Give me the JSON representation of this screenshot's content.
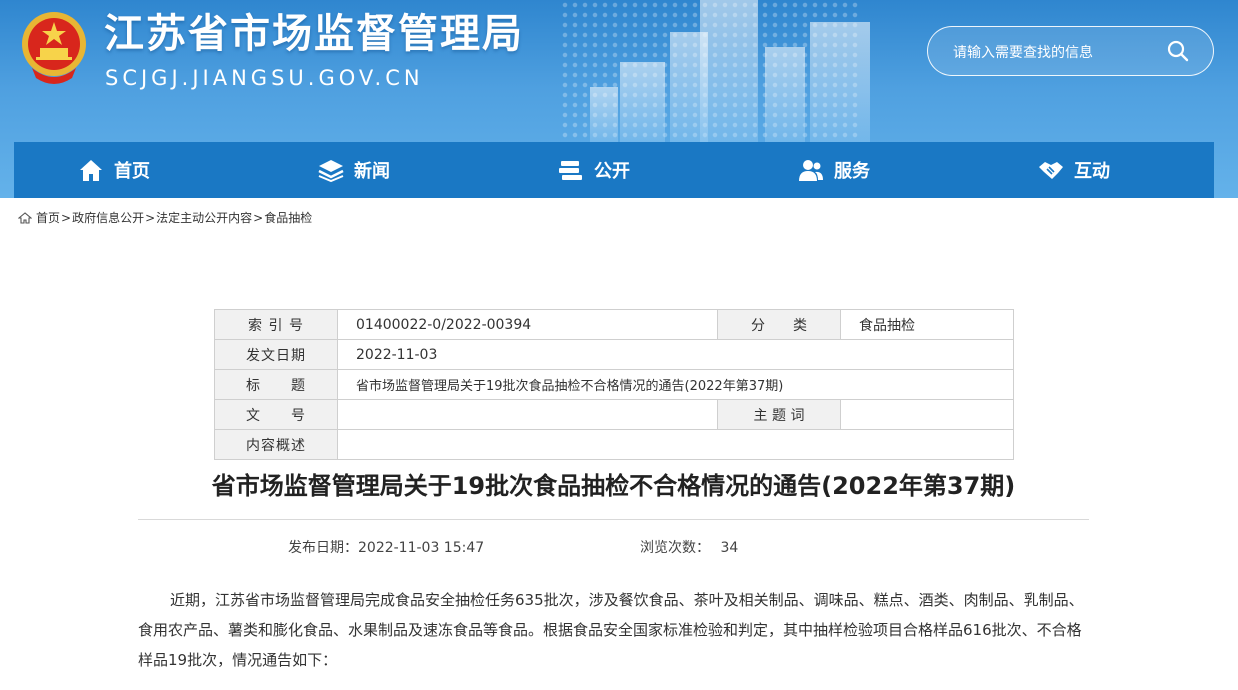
{
  "header": {
    "site_title": "江苏省市场监督管理局",
    "site_domain": "SCJGJ.JIANGSU.GOV.CN",
    "search_placeholder": "请输入需要查找的信息",
    "emblem_icon": "national-emblem-icon",
    "search_icon": "search-icon"
  },
  "nav": {
    "items": [
      {
        "label": "首页",
        "icon": "home-icon"
      },
      {
        "label": "新闻",
        "icon": "layers-icon"
      },
      {
        "label": "公开",
        "icon": "book-stack-icon"
      },
      {
        "label": "服务",
        "icon": "people-icon"
      },
      {
        "label": "互动",
        "icon": "handshake-icon"
      }
    ]
  },
  "breadcrumb": {
    "icon": "home-icon",
    "items": [
      "首页",
      "政府信息公开",
      "法定主动公开内容",
      "食品抽检"
    ],
    "separator": ">"
  },
  "info_table": {
    "index_label": "索 引 号",
    "index_value": "01400022-0/2022-00394",
    "category_label": "分　　类",
    "category_value": "食品抽检",
    "date_label": "发文日期",
    "date_value": "2022-11-03",
    "title_label": "标　　题",
    "title_value": "省市场监督管理局关于19批次食品抽检不合格情况的通告(2022年第37期)",
    "docno_label": "文　　号",
    "docno_value": "",
    "keyword_label": "主 题 词",
    "keyword_value": "",
    "summary_label": "内容概述",
    "summary_value": ""
  },
  "article": {
    "title": "省市场监督管理局关于19批次食品抽检不合格情况的通告(2022年第37期)",
    "publish_label": "发布日期：",
    "publish_value": "2022-11-03 15:47",
    "views_label": "浏览次数：",
    "views_value": "34",
    "paragraph": "近期，江苏省市场监督管理局完成食品安全抽检任务635批次，涉及餐饮食品、茶叶及相关制品、调味品、糕点、酒类、肉制品、乳制品、食用农产品、薯类和膨化食品、水果制品及速冻食品等食品。根据食品安全国家标准检验和判定，其中抽样检验项目合格样品616批次、不合格样品19批次，情况通告如下："
  },
  "colors": {
    "nav_bg": "#1a78c4",
    "header_bg": "#3f93da"
  }
}
